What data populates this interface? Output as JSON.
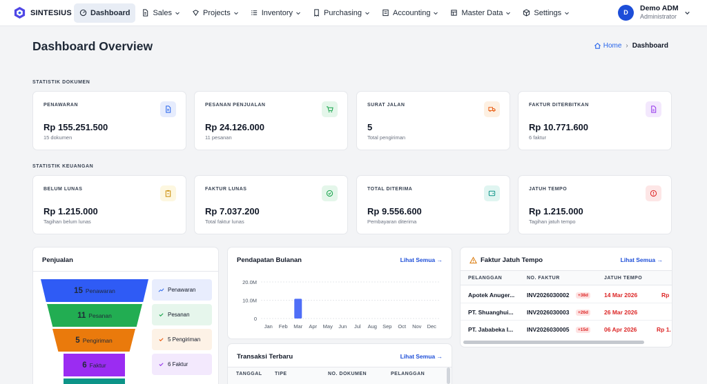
{
  "app": {
    "name": "SINTESIUS"
  },
  "nav": {
    "items": [
      {
        "label": "Dashboard"
      },
      {
        "label": "Sales"
      },
      {
        "label": "Projects"
      },
      {
        "label": "Inventory"
      },
      {
        "label": "Purchasing"
      },
      {
        "label": "Accounting"
      },
      {
        "label": "Master Data"
      },
      {
        "label": "Settings"
      }
    ]
  },
  "user": {
    "initial": "D",
    "name": "Demo ADM",
    "role": "Administrator"
  },
  "page": {
    "title": "Dashboard Overview"
  },
  "breadcrumb": {
    "home": "Home",
    "current": "Dashboard"
  },
  "doc_stats": {
    "section_label": "STATISTIK DOKUMEN",
    "cards": [
      {
        "label": "PENAWARAN",
        "value": "Rp 155.251.500",
        "sub": "15 dokumen",
        "icon": "document-icon",
        "color": "#2563eb"
      },
      {
        "label": "PESANAN PENJUALAN",
        "value": "Rp 24.126.000",
        "sub": "11 pesanan",
        "icon": "cart-icon",
        "color": "#16a34a"
      },
      {
        "label": "SURAT JALAN",
        "value": "5",
        "sub": "Total pengiriman",
        "icon": "truck-icon",
        "color": "#ea580c"
      },
      {
        "label": "FAKTUR DITERBITKAN",
        "value": "Rp 10.771.600",
        "sub": "6 faktur",
        "icon": "invoice-icon",
        "color": "#9333ea"
      }
    ]
  },
  "fin_stats": {
    "section_label": "STATISTIK KEUANGAN",
    "cards": [
      {
        "label": "BELUM LUNAS",
        "value": "Rp 1.215.000",
        "sub": "Tagihan belum lunas",
        "icon": "clipboard-icon",
        "color": "#ca8a04"
      },
      {
        "label": "FAKTUR LUNAS",
        "value": "Rp 7.037.200",
        "sub": "Total faktur lunas",
        "icon": "check-circle-icon",
        "color": "#16a34a"
      },
      {
        "label": "TOTAL DITERIMA",
        "value": "Rp 9.556.600",
        "sub": "Pembayaran diterima",
        "icon": "wallet-icon",
        "color": "#0d9488"
      },
      {
        "label": "JATUH TEMPO",
        "value": "Rp 1.215.000",
        "sub": "Tagihan jatuh tempo",
        "icon": "alert-circle-icon",
        "color": "#dc2626"
      }
    ]
  },
  "sales_panel": {
    "title": "Penjualan",
    "funnel": [
      {
        "count": "15",
        "label": "Penawaran",
        "color": "#2f5bf5"
      },
      {
        "count": "11",
        "label": "Pesanan",
        "color": "#22ad52"
      },
      {
        "count": "5",
        "label": "Pengiriman",
        "color": "#ea7a0c"
      },
      {
        "count": "6",
        "label": "Faktur",
        "color": "#9b2cf2"
      }
    ],
    "legend": [
      {
        "label": "Penawaran",
        "bg": "#e8edfd"
      },
      {
        "label": "Pesanan",
        "bg": "#e6f6ec"
      },
      {
        "label": "5 Pengiriman",
        "bg": "#fdf2e6"
      },
      {
        "label": "6 Faktur",
        "bg": "#f3e9fd"
      }
    ]
  },
  "revenue_panel": {
    "title": "Pendapatan Bulanan",
    "link": "Lihat Semua →"
  },
  "chart_data": {
    "type": "bar",
    "categories": [
      "Jan",
      "Feb",
      "Mar",
      "Apr",
      "May",
      "Jun",
      "Jul",
      "Aug",
      "Sep",
      "Oct",
      "Nov",
      "Dec"
    ],
    "values": [
      0,
      0,
      10.8,
      0,
      0,
      0,
      0,
      0,
      0,
      0,
      0,
      0
    ],
    "y_ticks": [
      "0",
      "10.0M",
      "20.0M"
    ],
    "ylim": [
      0,
      20
    ],
    "color": "#4f6ef7",
    "grid": true
  },
  "transactions_panel": {
    "title": "Transaksi Terbaru",
    "link": "Lihat Semua →",
    "columns": [
      "TANGGAL",
      "TIPE",
      "NO. DOKUMEN",
      "PELANGGAN"
    ]
  },
  "due_panel": {
    "title": "Faktur Jatuh Tempo",
    "link": "Lihat Semua →",
    "columns": [
      "PELANGGAN",
      "NO. FAKTUR",
      "JATUH TEMPO"
    ],
    "rows": [
      {
        "customer": "Apotek Anuger...",
        "invoice": "INV2026030002",
        "badge": "+38d",
        "due": "14 Mar 2026",
        "amount": "Rp"
      },
      {
        "customer": "PT. Shuanghui...",
        "invoice": "INV2026030003",
        "badge": "+26d",
        "due": "26 Mar 2026",
        "amount": ""
      },
      {
        "customer": "PT. Jababeka I...",
        "invoice": "INV2026030005",
        "badge": "+15d",
        "due": "06 Apr 2026",
        "amount": "Rp 1."
      }
    ]
  }
}
